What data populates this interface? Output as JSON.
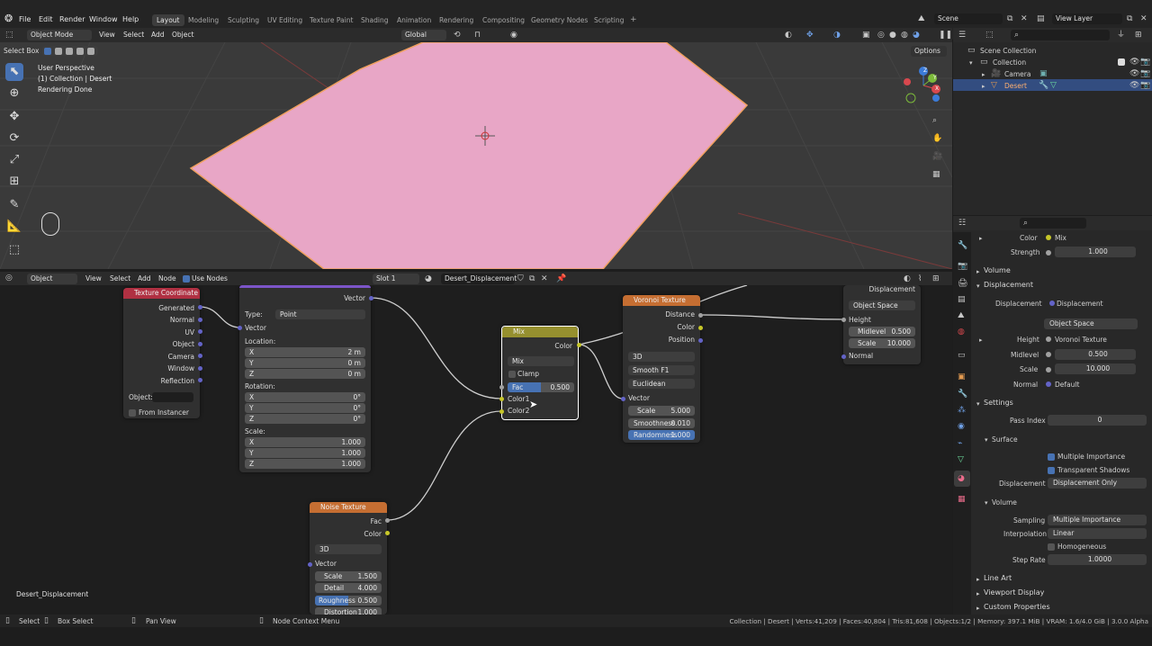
{
  "menu": [
    "File",
    "Edit",
    "Render",
    "Window",
    "Help"
  ],
  "workspaces": [
    {
      "label": "Layout",
      "active": true
    },
    {
      "label": "Modeling"
    },
    {
      "label": "Sculpting"
    },
    {
      "label": "UV Editing"
    },
    {
      "label": "Texture Paint"
    },
    {
      "label": "Shading"
    },
    {
      "label": "Animation"
    },
    {
      "label": "Rendering"
    },
    {
      "label": "Compositing"
    },
    {
      "label": "Geometry Nodes"
    },
    {
      "label": "Scripting"
    }
  ],
  "scene": "Scene",
  "view_layer": "View Layer",
  "viewport": {
    "select_box": "Select Box",
    "mode": "Object Mode",
    "menus": [
      "View",
      "Select",
      "Add",
      "Object"
    ],
    "orientation": "Global",
    "options": "Options",
    "overlay_info": [
      "User Perspective",
      "(1) Collection | Desert",
      "Rendering Done"
    ],
    "plane_color": "#e8a6c6",
    "gizmo_axes": {
      "x": "X",
      "y": "Y",
      "z": "Z"
    }
  },
  "node_editor": {
    "type": "Object",
    "menus": [
      "View",
      "Select",
      "Add",
      "Node"
    ],
    "use_nodes": "Use Nodes",
    "slot": "Slot 1",
    "material": "Desert_Displacement",
    "footer_label": "Desert_Displacement",
    "texture_coordinate": {
      "title": "Texture Coordinate",
      "outputs": [
        "Generated",
        "Normal",
        "UV",
        "Object",
        "Camera",
        "Window",
        "Reflection"
      ],
      "object_label": "Object:",
      "from_instancer": "From Instancer"
    },
    "mapping": {
      "output": "Vector",
      "type_label": "Type:",
      "type_value": "Point",
      "vector": "Vector",
      "location": "Location:",
      "loc": [
        [
          "X",
          "2 m"
        ],
        [
          "Y",
          "0 m"
        ],
        [
          "Z",
          "0 m"
        ]
      ],
      "rotation": "Rotation:",
      "rot": [
        [
          "X",
          "0°"
        ],
        [
          "Y",
          "0°"
        ],
        [
          "Z",
          "0°"
        ]
      ],
      "scale": "Scale:",
      "scl": [
        [
          "X",
          "1.000"
        ],
        [
          "Y",
          "1.000"
        ],
        [
          "Z",
          "1.000"
        ]
      ]
    },
    "mix": {
      "title": "Mix",
      "output": "Color",
      "blend": "Mix",
      "clamp": "Clamp",
      "fac_label": "Fac",
      "fac_value": "0.500",
      "inputs": [
        "Color1",
        "Color2"
      ]
    },
    "voronoi": {
      "title": "Voronoi Texture",
      "outputs": [
        "Distance",
        "Color",
        "Position"
      ],
      "dimensions": "3D",
      "feature": "Smooth F1",
      "metric": "Euclidean",
      "vector": "Vector",
      "fields": [
        [
          "Scale",
          "5.000"
        ],
        [
          "Smoothness",
          "0.010"
        ],
        [
          "Randomness",
          "1.000"
        ]
      ]
    },
    "displacement": {
      "output": "Displacement",
      "space": "Object Space",
      "height": "Height",
      "fields": [
        [
          "Midlevel",
          "0.500"
        ],
        [
          "Scale",
          "10.000"
        ]
      ],
      "normal": "Normal"
    },
    "noise": {
      "title": "Noise Texture",
      "outputs": [
        "Fac",
        "Color"
      ],
      "dimensions": "3D",
      "vector": "Vector",
      "fields": [
        [
          "Scale",
          "1.500"
        ],
        [
          "Detail",
          "4.000"
        ],
        [
          "Roughness",
          "0.500"
        ],
        [
          "Distortion",
          "1.000"
        ]
      ]
    }
  },
  "outliner": {
    "root": "Scene Collection",
    "items": [
      {
        "label": "Collection"
      },
      {
        "label": "Camera"
      },
      {
        "label": "Desert",
        "selected": true
      }
    ]
  },
  "properties": {
    "color_label": "Color",
    "color_value": "Mix",
    "strength_label": "Strength",
    "strength_value": "1.000",
    "volume": "Volume",
    "displacement_section": "Displacement",
    "displacement_label": "Displacement",
    "displacement_value": "Displacement",
    "space_value": "Object Space",
    "height_label": "Height",
    "height_value": "Voronoi Texture",
    "midlevel_label": "Midlevel",
    "midlevel_value": "0.500",
    "scale_label": "Scale",
    "scale_value": "10.000",
    "normal_label": "Normal",
    "normal_value": "Default",
    "settings": "Settings",
    "pass_index_label": "Pass Index",
    "pass_index_value": "0",
    "surface": "Surface",
    "multiple_importance": "Multiple Importance",
    "transparent_shadows": "Transparent Shadows",
    "disp_method_label": "Displacement",
    "disp_method_value": "Displacement Only",
    "volume_sub": "Volume",
    "sampling_label": "Sampling",
    "sampling_value": "Multiple Importance",
    "interpolation_label": "Interpolation",
    "interpolation_value": "Linear",
    "homogeneous": "Homogeneous",
    "step_rate_label": "Step Rate",
    "step_rate_value": "1.0000",
    "line_art": "Line Art",
    "viewport_display": "Viewport Display",
    "custom_properties": "Custom Properties"
  },
  "status": {
    "select": "Select",
    "box_select": "Box Select",
    "pan_view": "Pan View",
    "context_menu": "Node Context Menu",
    "info": "Collection | Desert | Verts:41,209 | Faces:40,804 | Tris:81,608 | Objects:1/2 | Memory: 397.1 MiB | VRAM: 1.6/4.0 GiB | 3.0.0 Alpha"
  },
  "colors": {
    "accent": "#4772b3",
    "selected_row": "#334d80",
    "texcoord_header": "#b03042",
    "mix_header": "#96902f",
    "voronoi_header": "#c56e32",
    "noise_header": "#c56e32"
  }
}
